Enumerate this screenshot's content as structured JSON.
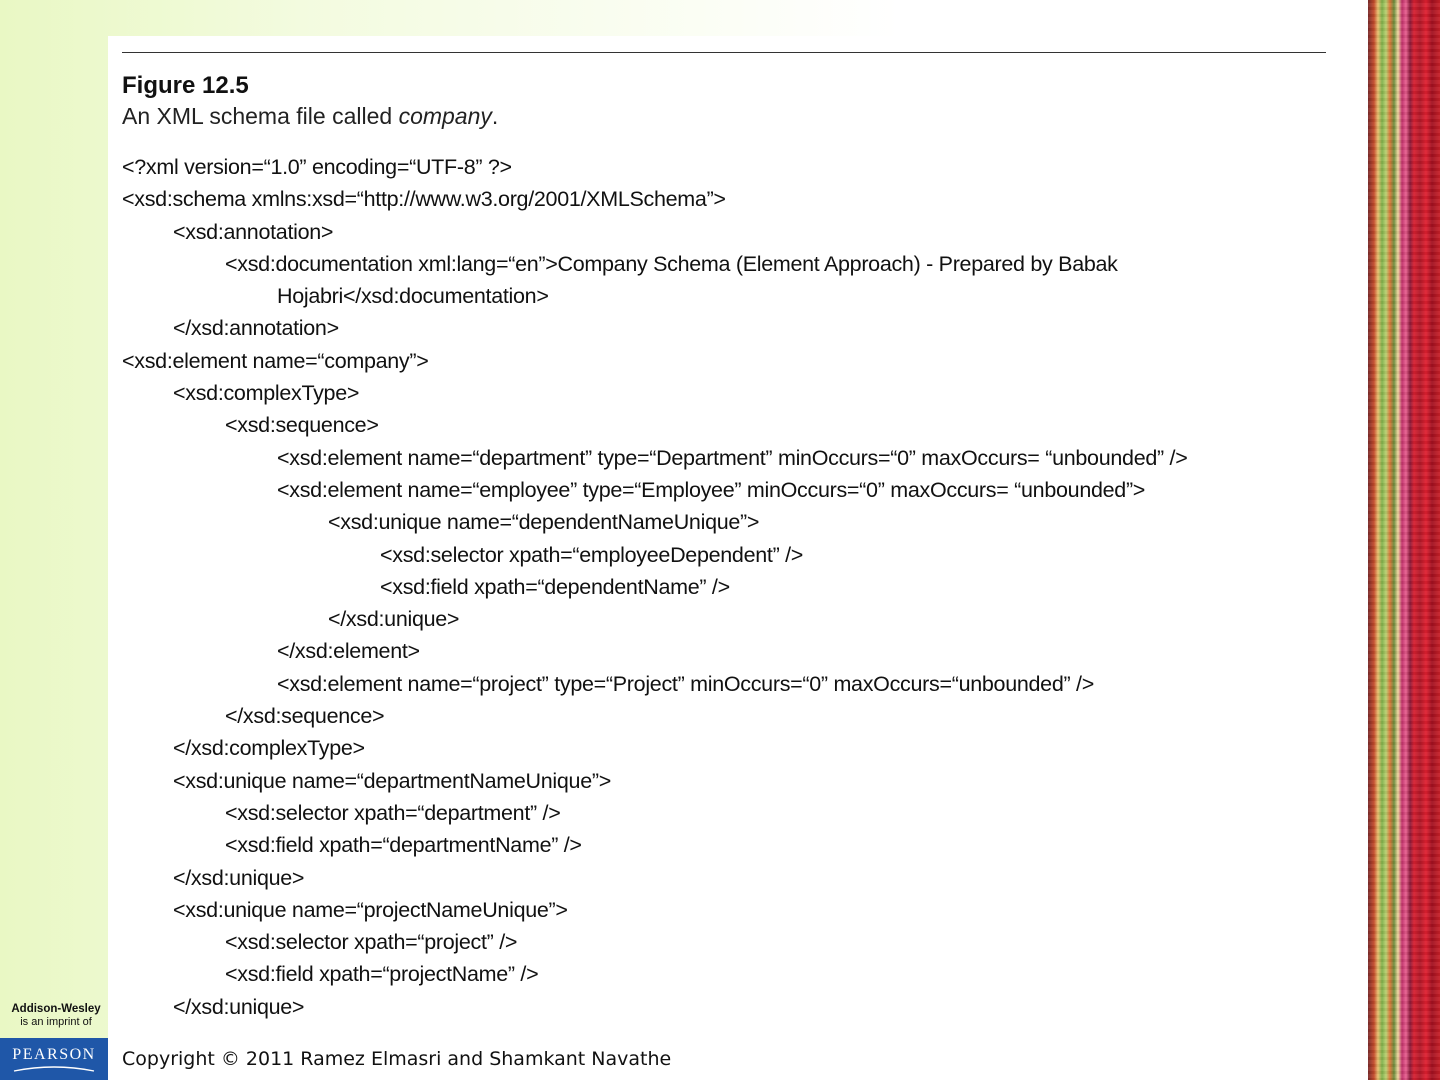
{
  "figure": {
    "label": "Figure 12.5",
    "caption_prefix": "An XML schema file called ",
    "caption_emphasis": "company",
    "caption_suffix": "."
  },
  "code_lines": [
    {
      "indent": 0,
      "text": "<?xml version=“1.0” encoding=“UTF-8” ?>"
    },
    {
      "indent": 0,
      "text": "<xsd:schema xmlns:xsd=“http://www.w3.org/2001/XMLSchema”>"
    },
    {
      "indent": 1,
      "text": "<xsd:annotation>"
    },
    {
      "indent": 2,
      "text": "<xsd:documentation xml:lang=“en”>Company Schema (Element Approach) - Prepared by Babak"
    },
    {
      "indent": 3,
      "text": "Hojabri</xsd:documentation>"
    },
    {
      "indent": 1,
      "text": "</xsd:annotation>"
    },
    {
      "indent": 0,
      "text": "<xsd:element name=“company”>"
    },
    {
      "indent": 1,
      "text": "<xsd:complexType>"
    },
    {
      "indent": 2,
      "text": "<xsd:sequence>"
    },
    {
      "indent": 3,
      "text": "<xsd:element name=“department” type=“Department” minOccurs=“0” maxOccurs= “unbounded” />"
    },
    {
      "indent": 3,
      "text": "<xsd:element name=“employee” type=“Employee” minOccurs=“0” maxOccurs= “unbounded”>"
    },
    {
      "indent": 4,
      "text": "<xsd:unique name=“dependentNameUnique”>"
    },
    {
      "indent": 5,
      "text": "<xsd:selector xpath=“employeeDependent” />"
    },
    {
      "indent": 5,
      "text": "<xsd:field xpath=“dependentName” />"
    },
    {
      "indent": 4,
      "text": "</xsd:unique>"
    },
    {
      "indent": 3,
      "text": "</xsd:element>"
    },
    {
      "indent": 3,
      "text": "<xsd:element name=“project” type=“Project” minOccurs=“0” maxOccurs=“unbounded” />"
    },
    {
      "indent": 2,
      "text": "</xsd:sequence>"
    },
    {
      "indent": 1,
      "text": "</xsd:complexType>"
    },
    {
      "indent": 1,
      "text": "<xsd:unique name=“departmentNameUnique”>"
    },
    {
      "indent": 2,
      "text": "<xsd:selector xpath=“department” />"
    },
    {
      "indent": 2,
      "text": "<xsd:field xpath=“departmentName” />"
    },
    {
      "indent": 1,
      "text": "</xsd:unique>"
    },
    {
      "indent": 1,
      "text": "<xsd:unique name=“projectNameUnique”>"
    },
    {
      "indent": 2,
      "text": "<xsd:selector xpath=“project” />"
    },
    {
      "indent": 2,
      "text": "<xsd:field xpath=“projectName” />"
    },
    {
      "indent": 1,
      "text": "</xsd:unique>"
    }
  ],
  "publisher": {
    "imprint_name": "Addison-Wesley",
    "imprint_sub": "is an imprint of",
    "logo_text": "PEARSON"
  },
  "footer": {
    "copyright": "Copyright © 2011 Ramez Elmasri and Shamkant Navathe"
  },
  "colors": {
    "pearson_blue": "#1f57a8",
    "background_green": "#e9f8c4"
  }
}
